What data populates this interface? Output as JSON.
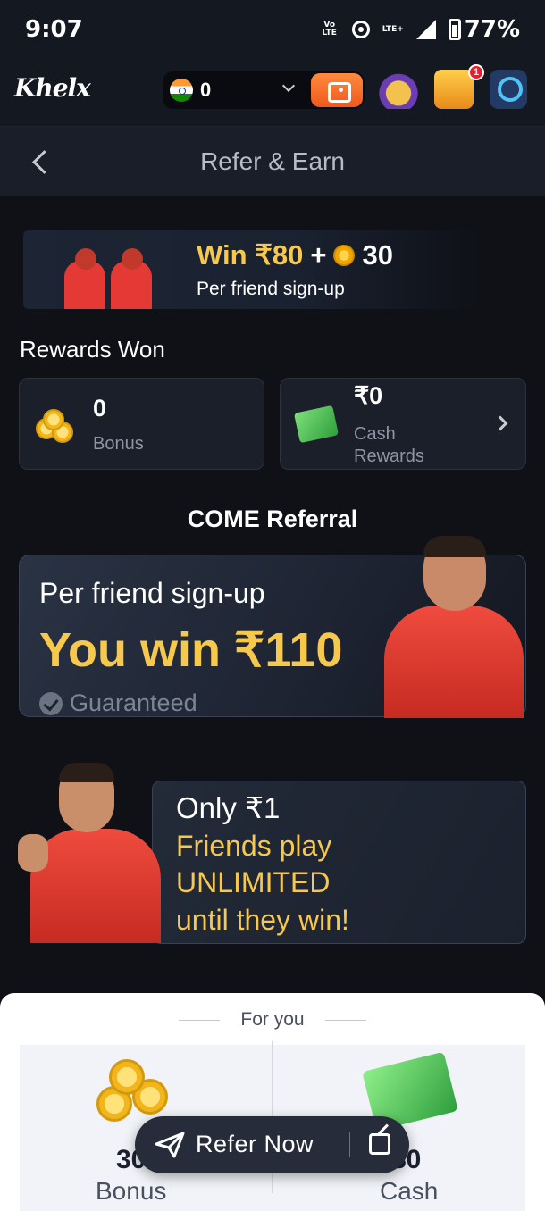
{
  "status_bar": {
    "time": "9:07",
    "volte": "Vo LTE",
    "lte": "LTE+",
    "battery": "77%"
  },
  "header": {
    "logo": "Khelx",
    "balance": "0",
    "notification_count": "1"
  },
  "title_bar": {
    "title": "Refer & Earn"
  },
  "win_banner": {
    "amount": "Win ₹80",
    "plus": "+",
    "coins": "30",
    "subtitle": "Per friend sign-up"
  },
  "rewards": {
    "heading": "Rewards Won",
    "bonus": {
      "value": "0",
      "label": "Bonus"
    },
    "cash": {
      "value": "₹0",
      "label": "Cash Rewards"
    }
  },
  "referral": {
    "heading": "COME Referral",
    "subtitle": "Per friend sign-up",
    "main": "You win ₹110",
    "guaranteed": "Guaranteed"
  },
  "only_card": {
    "title": "Only ₹1",
    "lines": [
      "Friends play",
      "UNLIMITED",
      "until they win!"
    ]
  },
  "sheet": {
    "heading": "For you",
    "bonus": {
      "value": "30",
      "label": "Bonus"
    },
    "cash": {
      "value": "80",
      "label": "Cash"
    }
  },
  "refer_button": {
    "label": "Refer Now"
  },
  "colors": {
    "accent": "#f6c84c",
    "background": "#0f1117",
    "wallet": "#f0581d"
  }
}
